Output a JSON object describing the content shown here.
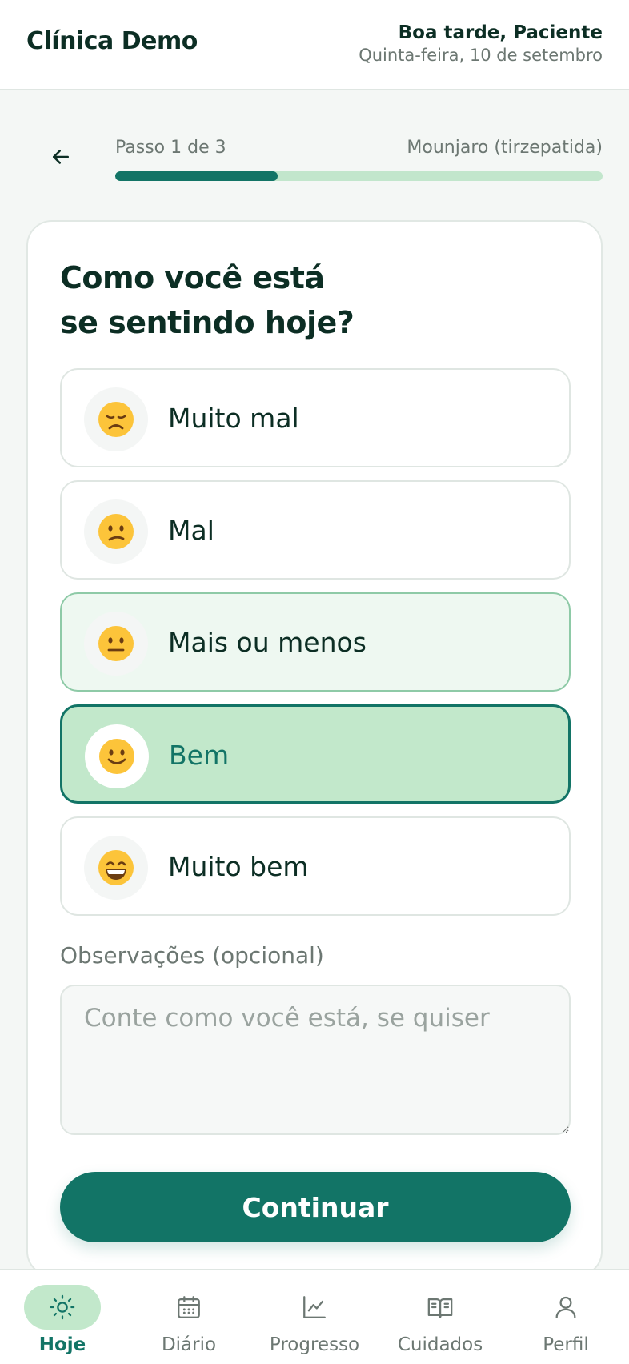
{
  "header": {
    "brand": "Clínica Demo",
    "greeting": "Boa tarde, Paciente",
    "date": "Quinta-feira, 10 de setembro"
  },
  "progress": {
    "step_label": "Passo 1 de 3",
    "medication": "Mounjaro (tirzepatida)",
    "current_step": 1,
    "total_steps": 3
  },
  "question": {
    "line1": "Como você está",
    "line2": "se sentindo hoje?"
  },
  "options": [
    {
      "label": "Muito mal",
      "icon": "very-sad-face-emoji",
      "state": "default"
    },
    {
      "label": "Mal",
      "icon": "confused-face-emoji",
      "state": "default"
    },
    {
      "label": "Mais ou menos",
      "icon": "neutral-face-emoji",
      "state": "hover"
    },
    {
      "label": "Bem",
      "icon": "slightly-smiling-face-emoji",
      "state": "selected"
    },
    {
      "label": "Muito bem",
      "icon": "grinning-face-emoji",
      "state": "default"
    }
  ],
  "notes": {
    "label": "Observações (opcional)",
    "placeholder": "Conte como você está, se quiser",
    "value": ""
  },
  "continue_label": "Continuar",
  "nav": {
    "items": [
      {
        "label": "Hoje",
        "icon": "sun-icon",
        "active": true
      },
      {
        "label": "Diário",
        "icon": "calendar-icon",
        "active": false
      },
      {
        "label": "Progresso",
        "icon": "chart-icon",
        "active": false
      },
      {
        "label": "Cuidados",
        "icon": "book-icon",
        "active": false
      },
      {
        "label": "Perfil",
        "icon": "user-icon",
        "active": false
      }
    ]
  },
  "colors": {
    "primary": "#127466",
    "selected_bg": "#c2e8cb",
    "hover_bg": "#eef8f1",
    "page_bg": "#f4f7f5"
  }
}
